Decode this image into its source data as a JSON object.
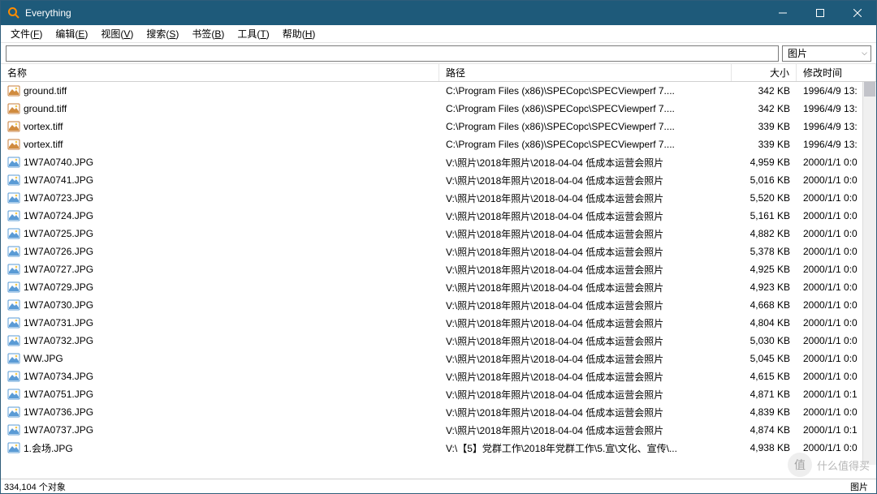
{
  "window": {
    "title": "Everything"
  },
  "menu": [
    {
      "label": "文件",
      "key": "F"
    },
    {
      "label": "编辑",
      "key": "E"
    },
    {
      "label": "视图",
      "key": "V"
    },
    {
      "label": "搜索",
      "key": "S"
    },
    {
      "label": "书签",
      "key": "B"
    },
    {
      "label": "工具",
      "key": "T"
    },
    {
      "label": "帮助",
      "key": "H"
    }
  ],
  "search": {
    "value": "",
    "placeholder": ""
  },
  "filter": {
    "selected": "图片"
  },
  "columns": {
    "name": "名称",
    "path": "路径",
    "size": "大小",
    "date": "修改时间"
  },
  "rows": [
    {
      "icon": "tiff",
      "name": "ground.tiff",
      "path": "C:\\Program Files (x86)\\SPECopc\\SPECViewperf 7....",
      "size": "342 KB",
      "date": "1996/4/9 13:"
    },
    {
      "icon": "tiff",
      "name": "ground.tiff",
      "path": "C:\\Program Files (x86)\\SPECopc\\SPECViewperf 7....",
      "size": "342 KB",
      "date": "1996/4/9 13:"
    },
    {
      "icon": "tiff",
      "name": "vortex.tiff",
      "path": "C:\\Program Files (x86)\\SPECopc\\SPECViewperf 7....",
      "size": "339 KB",
      "date": "1996/4/9 13:"
    },
    {
      "icon": "tiff",
      "name": "vortex.tiff",
      "path": "C:\\Program Files (x86)\\SPECopc\\SPECViewperf 7....",
      "size": "339 KB",
      "date": "1996/4/9 13:"
    },
    {
      "icon": "jpg",
      "name": "1W7A0740.JPG",
      "path": "V:\\照片\\2018年照片\\2018-04-04 低成本运营会照片",
      "size": "4,959 KB",
      "date": "2000/1/1 0:0"
    },
    {
      "icon": "jpg",
      "name": "1W7A0741.JPG",
      "path": "V:\\照片\\2018年照片\\2018-04-04 低成本运营会照片",
      "size": "5,016 KB",
      "date": "2000/1/1 0:0"
    },
    {
      "icon": "jpg",
      "name": "1W7A0723.JPG",
      "path": "V:\\照片\\2018年照片\\2018-04-04 低成本运营会照片",
      "size": "5,520 KB",
      "date": "2000/1/1 0:0"
    },
    {
      "icon": "jpg",
      "name": "1W7A0724.JPG",
      "path": "V:\\照片\\2018年照片\\2018-04-04 低成本运营会照片",
      "size": "5,161 KB",
      "date": "2000/1/1 0:0"
    },
    {
      "icon": "jpg",
      "name": "1W7A0725.JPG",
      "path": "V:\\照片\\2018年照片\\2018-04-04 低成本运营会照片",
      "size": "4,882 KB",
      "date": "2000/1/1 0:0"
    },
    {
      "icon": "jpg",
      "name": "1W7A0726.JPG",
      "path": "V:\\照片\\2018年照片\\2018-04-04 低成本运营会照片",
      "size": "5,378 KB",
      "date": "2000/1/1 0:0"
    },
    {
      "icon": "jpg",
      "name": "1W7A0727.JPG",
      "path": "V:\\照片\\2018年照片\\2018-04-04 低成本运营会照片",
      "size": "4,925 KB",
      "date": "2000/1/1 0:0"
    },
    {
      "icon": "jpg",
      "name": "1W7A0729.JPG",
      "path": "V:\\照片\\2018年照片\\2018-04-04 低成本运营会照片",
      "size": "4,923 KB",
      "date": "2000/1/1 0:0"
    },
    {
      "icon": "jpg",
      "name": "1W7A0730.JPG",
      "path": "V:\\照片\\2018年照片\\2018-04-04 低成本运营会照片",
      "size": "4,668 KB",
      "date": "2000/1/1 0:0"
    },
    {
      "icon": "jpg",
      "name": "1W7A0731.JPG",
      "path": "V:\\照片\\2018年照片\\2018-04-04 低成本运营会照片",
      "size": "4,804 KB",
      "date": "2000/1/1 0:0"
    },
    {
      "icon": "jpg",
      "name": "1W7A0732.JPG",
      "path": "V:\\照片\\2018年照片\\2018-04-04 低成本运营会照片",
      "size": "5,030 KB",
      "date": "2000/1/1 0:0"
    },
    {
      "icon": "jpg",
      "name": "WW.JPG",
      "path": "V:\\照片\\2018年照片\\2018-04-04 低成本运营会照片",
      "size": "5,045 KB",
      "date": "2000/1/1 0:0"
    },
    {
      "icon": "jpg",
      "name": "1W7A0734.JPG",
      "path": "V:\\照片\\2018年照片\\2018-04-04 低成本运营会照片",
      "size": "4,615 KB",
      "date": "2000/1/1 0:0"
    },
    {
      "icon": "jpg",
      "name": "1W7A0751.JPG",
      "path": "V:\\照片\\2018年照片\\2018-04-04 低成本运营会照片",
      "size": "4,871 KB",
      "date": "2000/1/1 0:1"
    },
    {
      "icon": "jpg",
      "name": "1W7A0736.JPG",
      "path": "V:\\照片\\2018年照片\\2018-04-04 低成本运营会照片",
      "size": "4,839 KB",
      "date": "2000/1/1 0:0"
    },
    {
      "icon": "jpg",
      "name": "1W7A0737.JPG",
      "path": "V:\\照片\\2018年照片\\2018-04-04 低成本运营会照片",
      "size": "4,874 KB",
      "date": "2000/1/1 0:1"
    },
    {
      "icon": "jpg",
      "name": "1.会场.JPG",
      "path": "V:\\【5】党群工作\\2018年党群工作\\5.宣\\文化、宣传\\...",
      "size": "4,938 KB",
      "date": "2000/1/1 0:0"
    }
  ],
  "statusbar": {
    "count": "334,104 个对象",
    "mode": "图片"
  },
  "watermark": {
    "text": "什么值得买",
    "badge": "值"
  }
}
